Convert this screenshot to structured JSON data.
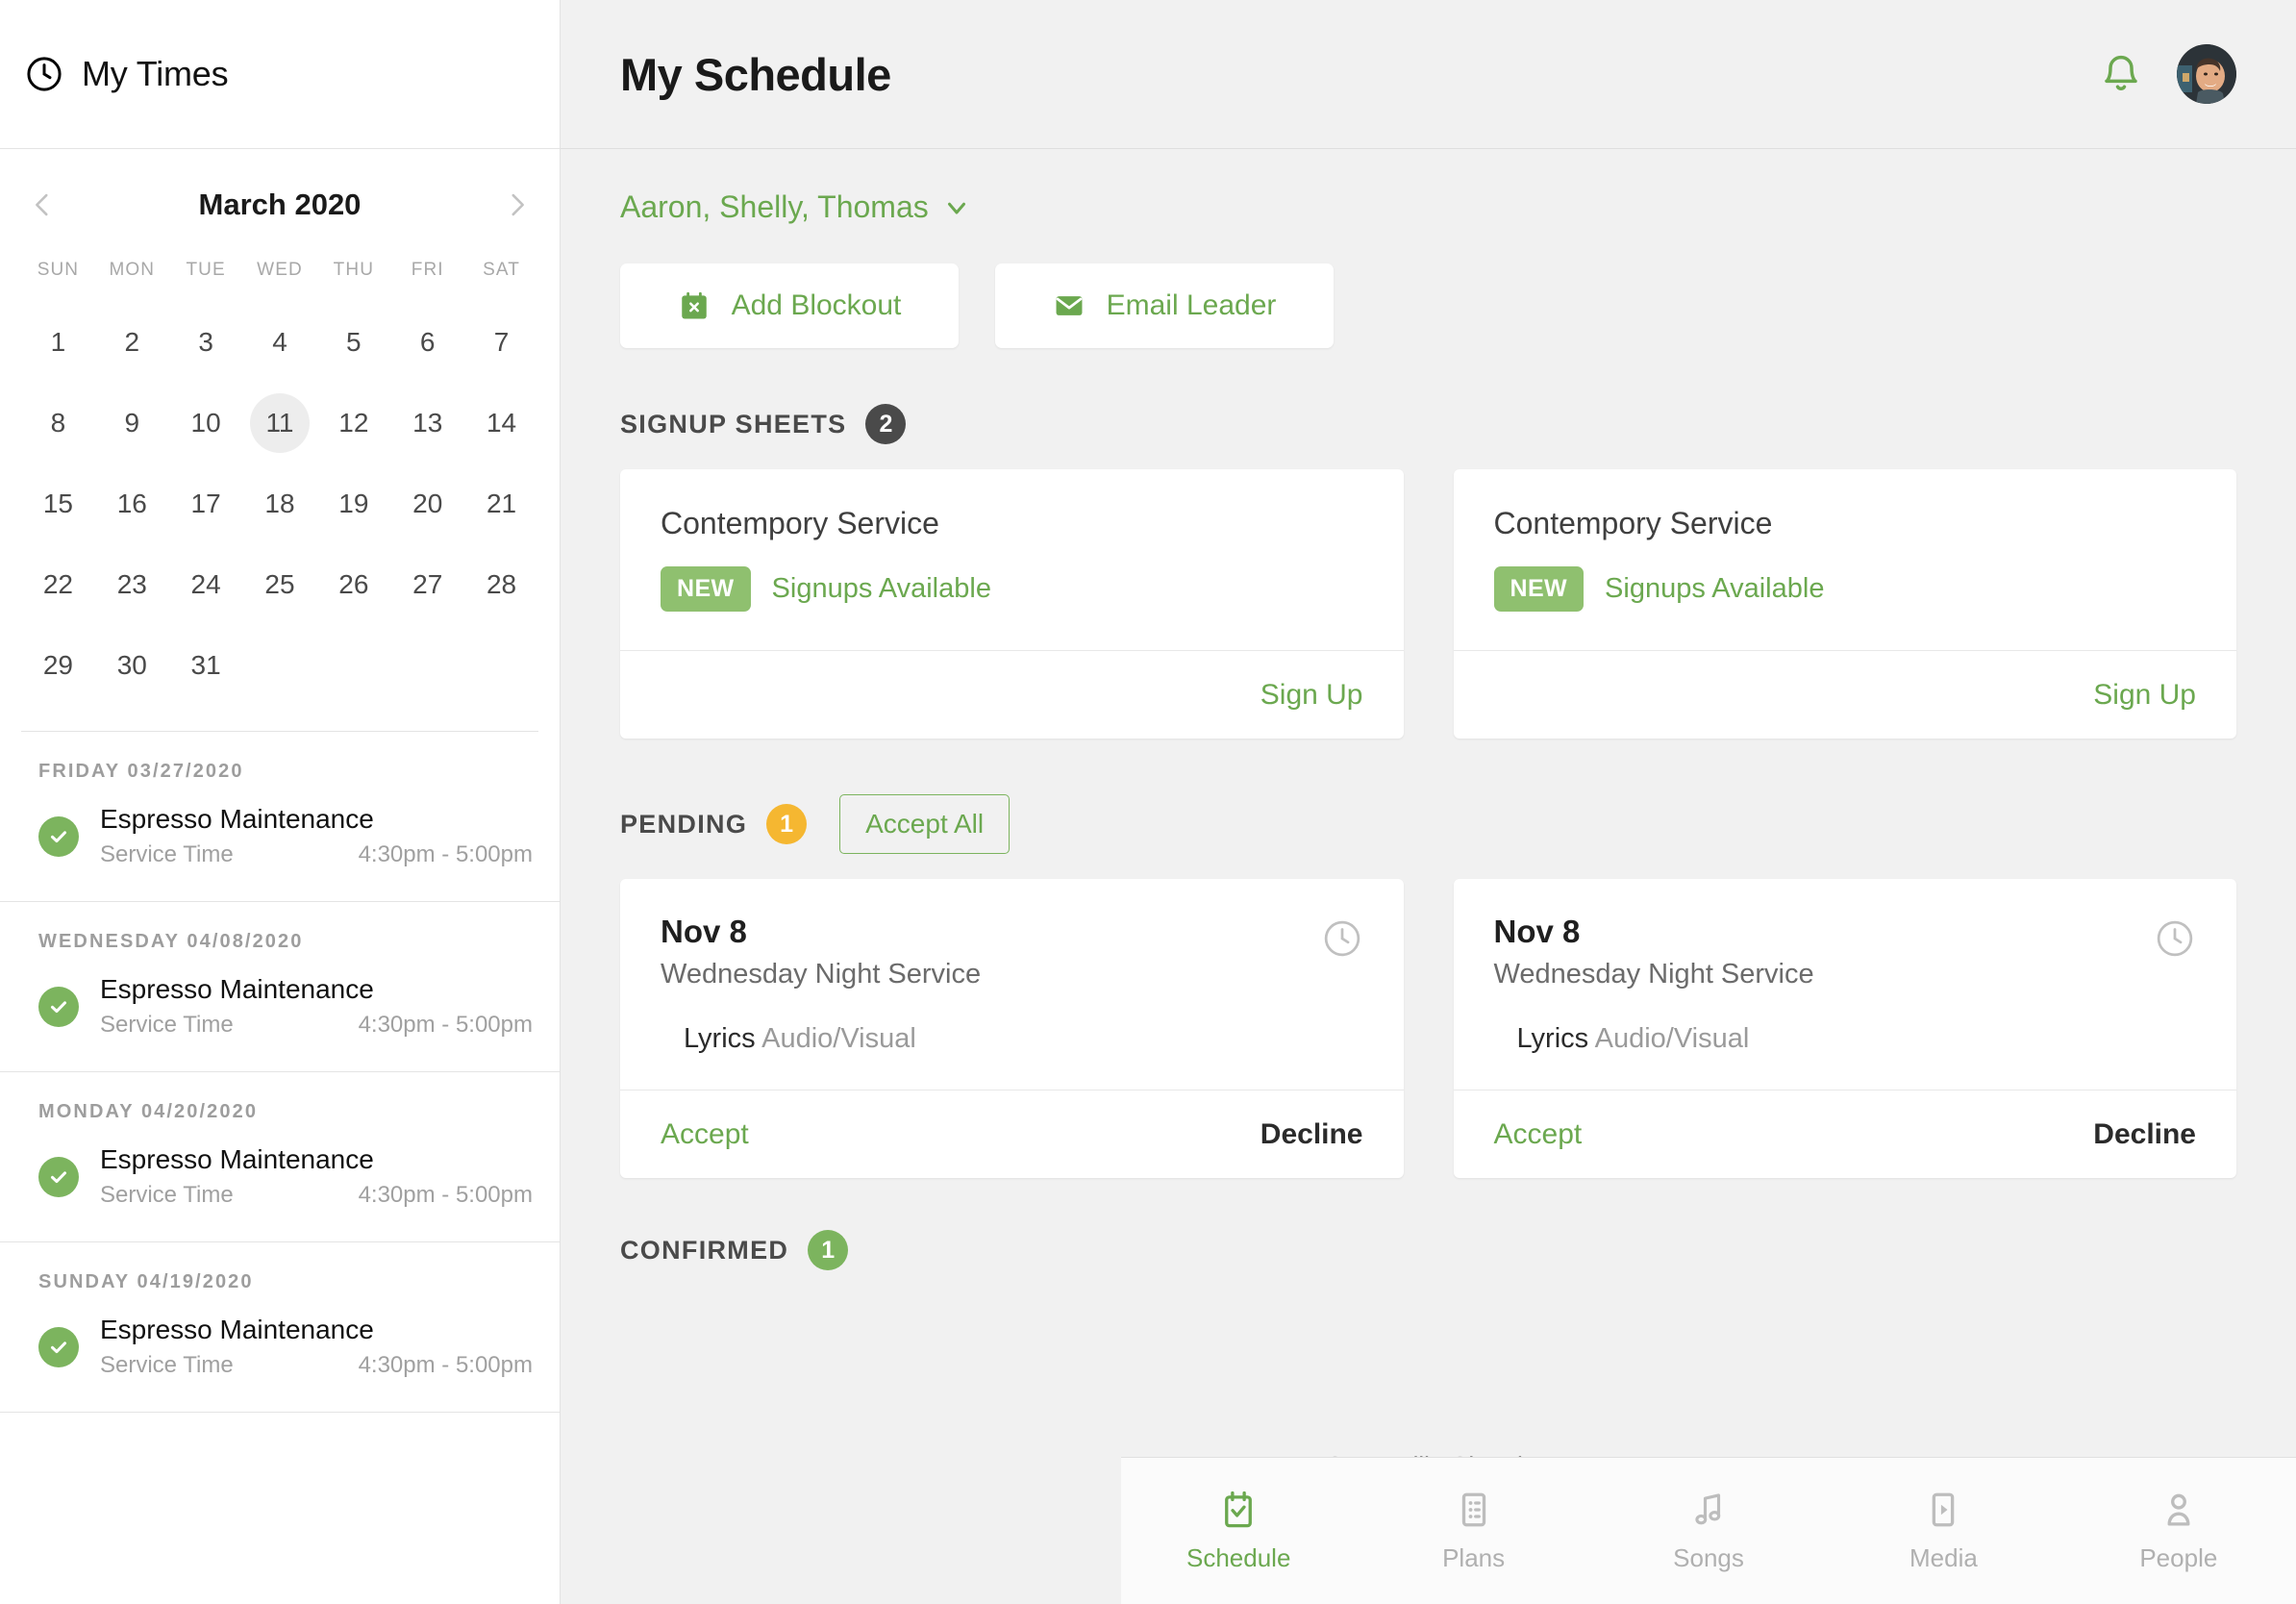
{
  "sidebar": {
    "title": "My Times",
    "clock_icon": "clock-icon",
    "calendar": {
      "month_label": "March 2020",
      "prev_icon": "chevron-left-icon",
      "next_icon": "chevron-right-icon",
      "day_headers": [
        "SUN",
        "MON",
        "TUE",
        "WED",
        "THU",
        "FRI",
        "SAT"
      ],
      "leading_blanks": 0,
      "days": [
        1,
        2,
        3,
        4,
        5,
        6,
        7,
        8,
        9,
        10,
        11,
        12,
        13,
        14,
        15,
        16,
        17,
        18,
        19,
        20,
        21,
        22,
        23,
        24,
        25,
        26,
        27,
        28,
        29,
        30,
        31
      ],
      "selected_day": 11
    },
    "events": [
      {
        "date_label": "FRIDAY 03/27/2020",
        "status_icon": "check-circle-icon",
        "name": "Espresso Maintenance",
        "kind": "Service Time",
        "time": "4:30pm - 5:00pm"
      },
      {
        "date_label": "WEDNESDAY 04/08/2020",
        "status_icon": "check-circle-icon",
        "name": "Espresso Maintenance",
        "kind": "Service Time",
        "time": "4:30pm - 5:00pm"
      },
      {
        "date_label": "MONDAY 04/20/2020",
        "status_icon": "check-circle-icon",
        "name": "Espresso Maintenance",
        "kind": "Service Time",
        "time": "4:30pm - 5:00pm"
      },
      {
        "date_label": "SUNDAY 04/19/2020",
        "status_icon": "check-circle-icon",
        "name": "Espresso Maintenance",
        "kind": "Service Time",
        "time": "4:30pm - 5:00pm"
      }
    ]
  },
  "header": {
    "title": "My Schedule",
    "bell_icon": "bell-icon",
    "avatar": "user-avatar",
    "team_names": "Aaron, Shelly, Thomas",
    "team_caret_icon": "chevron-down-icon"
  },
  "actions": [
    {
      "label": "Add Blockout",
      "icon": "calendar-x-icon"
    },
    {
      "label": "Email Leader",
      "icon": "envelope-icon"
    }
  ],
  "signup_sheets": {
    "section_label": "SIGNUP SHEETS",
    "count": "2",
    "cards": [
      {
        "title": "Contempory Service",
        "badge": "NEW",
        "status": "Signups Available",
        "action": "Sign Up"
      },
      {
        "title": "Contempory Service",
        "badge": "NEW",
        "status": "Signups Available",
        "action": "Sign Up"
      }
    ]
  },
  "pending": {
    "section_label": "PENDING",
    "count": "1",
    "accept_all_label": "Accept All",
    "cards": [
      {
        "date": "Nov 8",
        "service": "Wednesday Night Service",
        "position": "Lyrics",
        "team": "Audio/Visual",
        "clock_icon": "clock-icon",
        "accept_label": "Accept",
        "decline_label": "Decline"
      },
      {
        "date": "Nov 8",
        "service": "Wednesday Night Service",
        "position": "Lyrics",
        "team": "Audio/Visual",
        "clock_icon": "clock-icon",
        "accept_label": "Accept",
        "decline_label": "Decline"
      }
    ]
  },
  "confirmed": {
    "section_label": "CONFIRMED",
    "count": "1",
    "church_name": "Centerville Chruch"
  },
  "bottom_nav": [
    {
      "label": "Schedule",
      "icon": "calendar-check-icon",
      "active": true
    },
    {
      "label": "Plans",
      "icon": "list-icon",
      "active": false
    },
    {
      "label": "Songs",
      "icon": "music-note-icon",
      "active": false
    },
    {
      "label": "Media",
      "icon": "play-rect-icon",
      "active": false
    },
    {
      "label": "People",
      "icon": "person-icon",
      "active": false
    }
  ],
  "colors": {
    "accent_green": "#6ba84f",
    "badge_green": "#7cb45e",
    "badge_amber": "#f5b731",
    "badge_dark": "#4a4a4a",
    "panel_bg": "#f1f1f1"
  }
}
